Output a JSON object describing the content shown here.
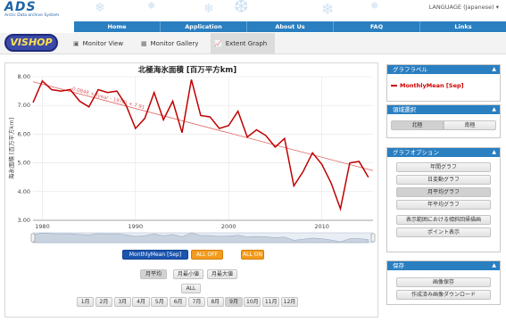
{
  "header": {
    "logo_main": "ADS",
    "logo_sub": "Arctic Data archive System",
    "language": "LANGUAGE (Japanese) ▾"
  },
  "nav": [
    "Home",
    "Application",
    "About Us",
    "FAQ",
    "Links"
  ],
  "toolbar": {
    "brand": "VISHOP",
    "tabs": [
      {
        "label": "Monitor View",
        "icon": "image-icon"
      },
      {
        "label": "Monitor Gallery",
        "icon": "gallery-icon"
      },
      {
        "label": "Extent Graph",
        "icon": "chart-icon"
      }
    ]
  },
  "chart_data": {
    "type": "line",
    "title": "北極海氷面積 [百万平方km]",
    "ylabel": "海氷面積 [百万平方km]",
    "xlabel": "",
    "x": [
      1979,
      1980,
      1981,
      1982,
      1983,
      1984,
      1985,
      1986,
      1987,
      1988,
      1989,
      1990,
      1991,
      1992,
      1993,
      1994,
      1995,
      1996,
      1997,
      1998,
      1999,
      2000,
      2001,
      2002,
      2003,
      2004,
      2005,
      2006,
      2007,
      2008,
      2009,
      2010,
      2011,
      2012,
      2013,
      2014,
      2015
    ],
    "series": [
      {
        "name": "MonthlyMean [Sep]",
        "color": "#c00000",
        "values": [
          7.1,
          7.85,
          7.55,
          7.5,
          7.55,
          7.15,
          6.95,
          7.55,
          7.45,
          7.5,
          7.0,
          6.2,
          6.55,
          7.45,
          6.5,
          7.15,
          6.05,
          7.9,
          6.65,
          6.6,
          6.2,
          6.3,
          6.8,
          5.9,
          6.15,
          5.95,
          5.55,
          5.85,
          4.2,
          4.7,
          5.35,
          4.95,
          4.3,
          3.4,
          5.0,
          5.05,
          4.5
        ]
      }
    ],
    "trend": {
      "label": "-0.0848 × (year - 1978) + 7.91",
      "color": "#e06060"
    },
    "ylim": [
      3.0,
      8.0
    ],
    "yticks": [
      "3.00",
      "4.00",
      "5.00",
      "6.00",
      "7.00",
      "8.00"
    ],
    "xticks": [
      "1980",
      "1990",
      "2000",
      "2010"
    ],
    "grid": true
  },
  "series_buttons": {
    "series": "MonthlyMean [Sep]",
    "all_off": "ALL OFF",
    "all_on": "ALL ON"
  },
  "stat_buttons": [
    "月平均",
    "月最小値",
    "月最大値"
  ],
  "all_button": "ALL",
  "months": [
    "1月",
    "2月",
    "3月",
    "4月",
    "5月",
    "6月",
    "7月",
    "8月",
    "9月",
    "10月",
    "11月",
    "12月"
  ],
  "selected_month": "9月",
  "panels": {
    "legend": {
      "title": "グラフラベル",
      "item": "MonthlyMean [Sep]"
    },
    "region": {
      "title": "領域選択",
      "options": [
        "北極",
        "南極"
      ],
      "selected": "北極"
    },
    "options": {
      "title": "グラフオプション",
      "items": [
        "年間グラフ",
        "日変動グラフ",
        "月平均グラフ",
        "年平均グラフ"
      ],
      "pressed": "月平均グラフ",
      "extra": [
        "表示範囲における傾斜回帰描画",
        "ポイント表示"
      ]
    },
    "save": {
      "title": "保存",
      "items": [
        "画像保存",
        "作成済み画像ダウンロード"
      ]
    }
  },
  "colors": {
    "nav": "#2a7fc1",
    "line": "#c00000",
    "accent_orange": "#f39b1e",
    "accent_blue": "#1b55b0"
  }
}
